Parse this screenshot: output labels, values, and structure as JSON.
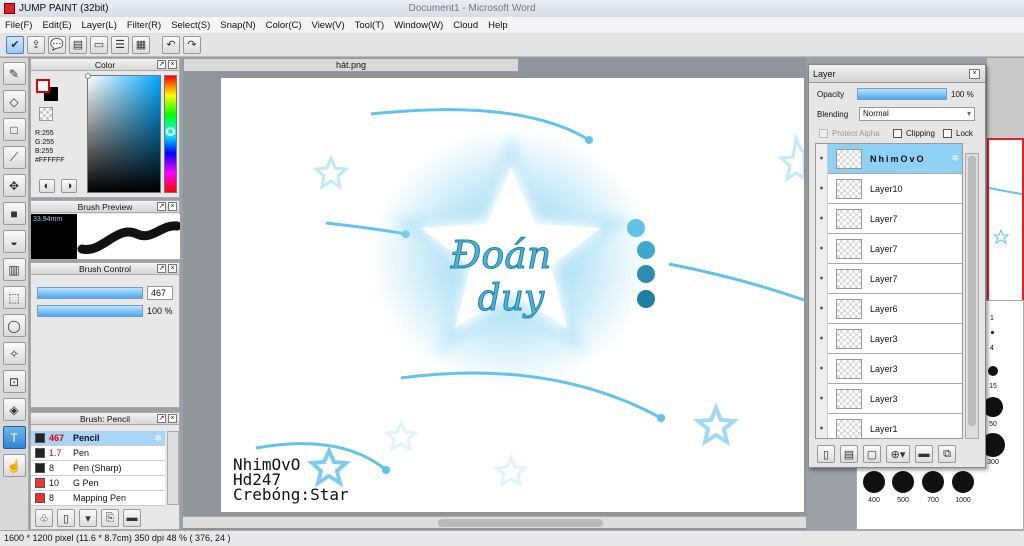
{
  "app": {
    "title": "JUMP PAINT (32bit)",
    "bg_window_title": "Document1 - Microsoft Word"
  },
  "menu": [
    "File(F)",
    "Edit(E)",
    "Layer(L)",
    "Filter(R)",
    "Select(S)",
    "Snap(N)",
    "Color(C)",
    "View(V)",
    "Tool(T)",
    "Window(W)",
    "Cloud",
    "Help"
  ],
  "document": {
    "tab": "hát.png"
  },
  "color_panel": {
    "title": "Color",
    "r": "R:255",
    "g": "G:255",
    "b": "B:255",
    "hex": "#FFFFFF"
  },
  "brush_preview": {
    "title": "Brush Preview",
    "size": "33.94mm"
  },
  "brush_control": {
    "title": "Brush Control",
    "size_value": "467",
    "opacity_value": "100 %"
  },
  "brush_list": {
    "title": "Brush: Pencil",
    "items": [
      {
        "size": "467",
        "name": "Pencil",
        "selected": true
      },
      {
        "size": "1.7",
        "name": "Pen",
        "selected": false
      },
      {
        "size": "8",
        "name": "Pen (Sharp)",
        "selected": false
      },
      {
        "size": "10",
        "name": "G Pen",
        "selected": false
      },
      {
        "size": "8",
        "name": "Mapping Pen",
        "selected": false
      }
    ]
  },
  "layer_panel": {
    "title": "Layer",
    "opacity_label": "Opacity",
    "opacity_value": "100 %",
    "opacity_level": 1.0,
    "blending_label": "Blending",
    "blending_value": "Normal",
    "protect_alpha": "Protect Alpha",
    "clipping": "Clipping",
    "lock": "Lock",
    "layers": [
      {
        "name": "NhimOvO",
        "selected": true
      },
      {
        "name": "Layer10",
        "selected": false
      },
      {
        "name": "Layer7",
        "selected": false
      },
      {
        "name": "Layer7",
        "selected": false
      },
      {
        "name": "Layer7",
        "selected": false
      },
      {
        "name": "Layer6",
        "selected": false
      },
      {
        "name": "Layer3",
        "selected": false
      },
      {
        "name": "Layer3",
        "selected": false
      },
      {
        "name": "Layer3",
        "selected": false
      },
      {
        "name": "Layer1",
        "selected": false
      }
    ]
  },
  "artwork": {
    "main_text_1": "Đoán",
    "main_text_2": "duy",
    "credit_1": "NhimOvO",
    "credit_2": "Hd247",
    "credit_3": "Crebóng:Star"
  },
  "brush_sizes": {
    "labels": [
      "1",
      "4",
      "15",
      "50",
      "300",
      "400",
      "500",
      "700",
      "1000"
    ]
  },
  "status": {
    "text": "1600 * 1200 pixel  (11.6 * 8.7cm)  350 dpi  48 %  ( 376, 24 )"
  },
  "colors": {
    "accent": "#4aa8ee",
    "art_blue": "#5fc3ea",
    "art_dark": "#1f7fa5"
  }
}
